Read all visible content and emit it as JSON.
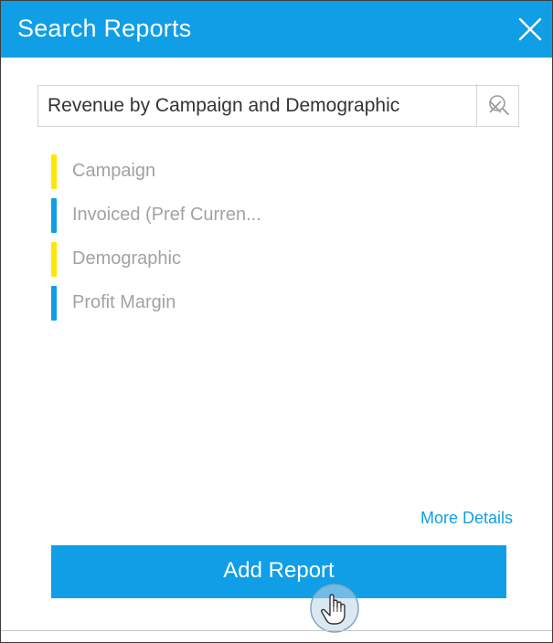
{
  "dialog": {
    "title": "Search Reports",
    "close_icon": "close-icon"
  },
  "search": {
    "value": "Revenue by Campaign and Demographic",
    "clear_icon": "clear-icon",
    "search_icon": "search-icon"
  },
  "fields": [
    {
      "label": "Campaign",
      "type": "dimension",
      "color": "#ffe600"
    },
    {
      "label": "Invoiced (Pref Curren...",
      "type": "metric",
      "color": "#109ee6"
    },
    {
      "label": "Demographic",
      "type": "dimension",
      "color": "#ffe600"
    },
    {
      "label": "Profit Margin",
      "type": "metric",
      "color": "#109ee6"
    }
  ],
  "footer": {
    "more_details": "More Details",
    "add_report": "Add Report"
  },
  "colors": {
    "accent": "#109ee6",
    "dimension": "#ffe600",
    "metric": "#109ee6"
  },
  "cursor_icon": "hand-pointer-icon"
}
